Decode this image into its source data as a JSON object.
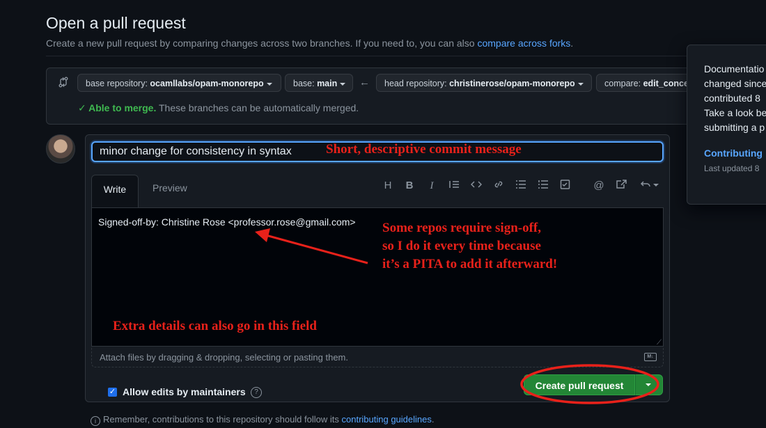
{
  "page": {
    "title": "Open a pull request",
    "subtitle": "Create a new pull request by comparing changes across two branches. If you need to, you can also ",
    "subtitle_link": "compare across forks",
    "subtitle_end": "."
  },
  "branches": {
    "base_repo_label": "base repository: ",
    "base_repo_value": "ocamllabs/opam-monorepo",
    "base_label": "base: ",
    "base_value": "main",
    "head_repo_label": "head repository: ",
    "head_repo_value": "christinerose/opam-monorepo",
    "compare_label": "compare: ",
    "compare_value": "edit_conce",
    "merge_ok": "Able to merge.",
    "merge_text": " These branches can be automatically merged."
  },
  "compose": {
    "title_value": "minor change for consistency in syntax",
    "tab_write": "Write",
    "tab_preview": "Preview",
    "body_text": "Signed-off-by: Christine Rose <professor.rose@gmail.com>",
    "attach_text": "Attach files by dragging & dropping, selecting or pasting them.",
    "md_badge": "M↓",
    "allow_edits": "Allow edits by maintainers",
    "create_button": "Create pull request"
  },
  "toolbar": [
    "H",
    "B",
    "I",
    "quote",
    "code",
    "link",
    "ul",
    "ol",
    "tasklist",
    "mention",
    "reference",
    "undo"
  ],
  "footer": {
    "remember_text": "Remember, contributions to this repository should follow its ",
    "remember_link": "contributing guidelines",
    "remember_end": "."
  },
  "popover": {
    "lines": [
      "Documentatio",
      "changed since",
      "contributed 8",
      "Take a look be",
      "submitting a p"
    ],
    "link": "Contributing",
    "meta": "Last updated 8"
  },
  "annotations": {
    "commit": "Short, descriptive commit message",
    "signoff_1": "Some repos require sign-off,",
    "signoff_2": "so I do it every time because",
    "signoff_3": "it’s a PITA to add it afterward!",
    "extra": "Extra details can also go in this field"
  },
  "colors": {
    "background": "#0d1117",
    "accent": "#58a6ff",
    "success": "#238636",
    "annotation": "#e8211a"
  }
}
